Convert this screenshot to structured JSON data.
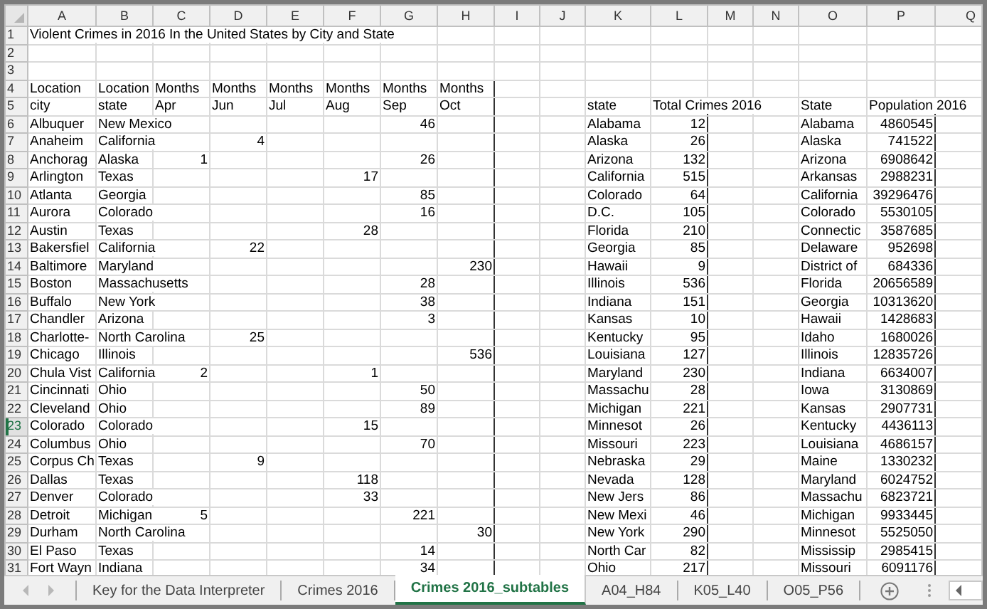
{
  "column_headers": [
    "A",
    "B",
    "C",
    "D",
    "E",
    "F",
    "G",
    "H",
    "I",
    "J",
    "K",
    "L",
    "M",
    "N",
    "O",
    "P",
    "Q"
  ],
  "rows": [
    {
      "number": "1",
      "selected": false,
      "texts": {
        "A": "Violent Crimes in  2016 In the United States by City and State"
      }
    },
    {
      "number": "2",
      "selected": false
    },
    {
      "number": "3",
      "selected": false
    },
    {
      "number": "4",
      "selected": false,
      "texts": {
        "A": "Location",
        "B": "Location",
        "C": "Months",
        "D": "Months",
        "E": "Months",
        "F": "Months",
        "G": "Months",
        "H": "Months"
      }
    },
    {
      "number": "5",
      "selected": false,
      "texts": {
        "A": "city",
        "B": "state",
        "C": "Apr",
        "D": "Jun",
        "E": "Jul",
        "F": "Aug",
        "G": "Sep",
        "H": "Oct",
        "K": "state",
        "L": "Total Crimes 2016",
        "O": "State",
        "P": "Population 2016"
      }
    },
    {
      "number": "6",
      "selected": false,
      "texts": {
        "A": "Albuquer",
        "B": "New Mexico",
        "K": "Alabama",
        "O": "Alabama"
      },
      "numbers": {
        "G": "46",
        "L": "12",
        "P": "4860545"
      }
    },
    {
      "number": "7",
      "selected": false,
      "texts": {
        "A": "Anaheim",
        "B": "California",
        "K": "Alaska",
        "O": "Alaska"
      },
      "numbers": {
        "D": "4",
        "L": "26",
        "P": "741522"
      }
    },
    {
      "number": "8",
      "selected": false,
      "texts": {
        "A": "Anchorag",
        "B": "Alaska",
        "K": "Arizona",
        "O": "Arizona"
      },
      "numbers": {
        "C": "1",
        "G": "26",
        "L": "132",
        "P": "6908642"
      }
    },
    {
      "number": "9",
      "selected": false,
      "texts": {
        "A": "Arlington",
        "B": "Texas",
        "K": "California",
        "O": "Arkansas"
      },
      "numbers": {
        "F": "17",
        "L": "515",
        "P": "2988231"
      }
    },
    {
      "number": "10",
      "selected": false,
      "texts": {
        "A": "Atlanta",
        "B": "Georgia",
        "K": "Colorado",
        "O": "California"
      },
      "numbers": {
        "G": "85",
        "L": "64",
        "P": "39296476"
      }
    },
    {
      "number": "11",
      "selected": false,
      "texts": {
        "A": "Aurora",
        "B": "Colorado",
        "K": "D.C.",
        "O": "Colorado"
      },
      "numbers": {
        "G": "16",
        "L": "105",
        "P": "5530105"
      }
    },
    {
      "number": "12",
      "selected": false,
      "texts": {
        "A": "Austin",
        "B": "Texas",
        "K": "Florida",
        "O": "Connectic"
      },
      "numbers": {
        "F": "28",
        "L": "210",
        "P": "3587685"
      }
    },
    {
      "number": "13",
      "selected": false,
      "texts": {
        "A": "Bakersfiel",
        "B": "California",
        "K": "Georgia",
        "O": "Delaware"
      },
      "numbers": {
        "D": "22",
        "L": "85",
        "P": "952698"
      }
    },
    {
      "number": "14",
      "selected": false,
      "texts": {
        "A": "Baltimore",
        "B": "Maryland",
        "K": "Hawaii",
        "O": "District of"
      },
      "numbers": {
        "H": "230",
        "L": "9",
        "P": "684336"
      }
    },
    {
      "number": "15",
      "selected": false,
      "texts": {
        "A": "Boston",
        "B": "Massachusetts",
        "K": "Illinois",
        "O": "Florida"
      },
      "numbers": {
        "G": "28",
        "L": "536",
        "P": "20656589"
      }
    },
    {
      "number": "16",
      "selected": false,
      "texts": {
        "A": "Buffalo",
        "B": "New York",
        "K": "Indiana",
        "O": "Georgia"
      },
      "numbers": {
        "G": "38",
        "L": "151",
        "P": "10313620"
      }
    },
    {
      "number": "17",
      "selected": false,
      "texts": {
        "A": "Chandler",
        "B": "Arizona",
        "K": "Kansas",
        "O": "Hawaii"
      },
      "numbers": {
        "G": "3",
        "L": "10",
        "P": "1428683"
      }
    },
    {
      "number": "18",
      "selected": false,
      "texts": {
        "A": "Charlotte-",
        "B": "North Carolina",
        "K": "Kentucky",
        "O": "Idaho"
      },
      "numbers": {
        "D": "25",
        "L": "95",
        "P": "1680026"
      }
    },
    {
      "number": "19",
      "selected": false,
      "texts": {
        "A": "Chicago",
        "B": "Illinois",
        "K": "Louisiana",
        "O": "Illinois"
      },
      "numbers": {
        "H": "536",
        "L": "127",
        "P": "12835726"
      }
    },
    {
      "number": "20",
      "selected": false,
      "texts": {
        "A": "Chula Vist",
        "B": "California",
        "K": "Maryland",
        "O": "Indiana"
      },
      "numbers": {
        "C": "2",
        "F": "1",
        "L": "230",
        "P": "6634007"
      }
    },
    {
      "number": "21",
      "selected": false,
      "texts": {
        "A": "Cincinnati",
        "B": "Ohio",
        "K": "Massachu",
        "O": "Iowa"
      },
      "numbers": {
        "G": "50",
        "L": "28",
        "P": "3130869"
      }
    },
    {
      "number": "22",
      "selected": false,
      "texts": {
        "A": "Cleveland",
        "B": "Ohio",
        "K": "Michigan",
        "O": "Kansas"
      },
      "numbers": {
        "G": "89",
        "L": "221",
        "P": "2907731"
      }
    },
    {
      "number": "23",
      "selected": true,
      "texts": {
        "A": "Colorado",
        "B": "Colorado",
        "K": "Minnesot",
        "O": "Kentucky"
      },
      "numbers": {
        "F": "15",
        "L": "26",
        "P": "4436113"
      }
    },
    {
      "number": "24",
      "selected": false,
      "texts": {
        "A": "Columbus",
        "B": "Ohio",
        "K": "Missouri",
        "O": "Louisiana"
      },
      "numbers": {
        "G": "70",
        "L": "223",
        "P": "4686157"
      }
    },
    {
      "number": "25",
      "selected": false,
      "texts": {
        "A": "Corpus Ch",
        "B": "Texas",
        "K": "Nebraska",
        "O": "Maine"
      },
      "numbers": {
        "D": "9",
        "L": "29",
        "P": "1330232"
      }
    },
    {
      "number": "26",
      "selected": false,
      "texts": {
        "A": "Dallas",
        "B": "Texas",
        "K": "Nevada",
        "O": "Maryland"
      },
      "numbers": {
        "F": "118",
        "L": "128",
        "P": "6024752"
      }
    },
    {
      "number": "27",
      "selected": false,
      "texts": {
        "A": "Denver",
        "B": "Colorado",
        "K": "New Jers",
        "O": "Massachu"
      },
      "numbers": {
        "F": "33",
        "L": "86",
        "P": "6823721"
      }
    },
    {
      "number": "28",
      "selected": false,
      "texts": {
        "A": "Detroit",
        "B": "Michigan",
        "K": "New Mexi",
        "O": "Michigan"
      },
      "numbers": {
        "C": "5",
        "G": "221",
        "L": "46",
        "P": "9933445"
      }
    },
    {
      "number": "29",
      "selected": false,
      "texts": {
        "A": "Durham",
        "B": "North Carolina",
        "K": "New York",
        "O": "Minnesot"
      },
      "numbers": {
        "H": "30",
        "L": "290",
        "P": "5525050"
      }
    },
    {
      "number": "30",
      "selected": false,
      "texts": {
        "A": "El Paso",
        "B": "Texas",
        "K": "North Car",
        "O": "Mississip"
      },
      "numbers": {
        "G": "14",
        "L": "82",
        "P": "2985415"
      }
    },
    {
      "number": "31",
      "selected": false,
      "texts": {
        "A": "Fort Wayn",
        "B": "Indiana",
        "K": "Ohio",
        "O": "Missouri"
      },
      "numbers": {
        "G": "34",
        "L": "217",
        "P": "6091176"
      }
    }
  ],
  "sheet_tabs": [
    {
      "label": "Key for the Data Interpreter",
      "selected": false
    },
    {
      "label": "Crimes 2016",
      "selected": false
    },
    {
      "label": "Crimes 2016_subtables",
      "selected": true
    },
    {
      "label": "A04_H84",
      "selected": false
    },
    {
      "label": "K05_L40",
      "selected": false
    },
    {
      "label": "O05_P56",
      "selected": false
    }
  ]
}
